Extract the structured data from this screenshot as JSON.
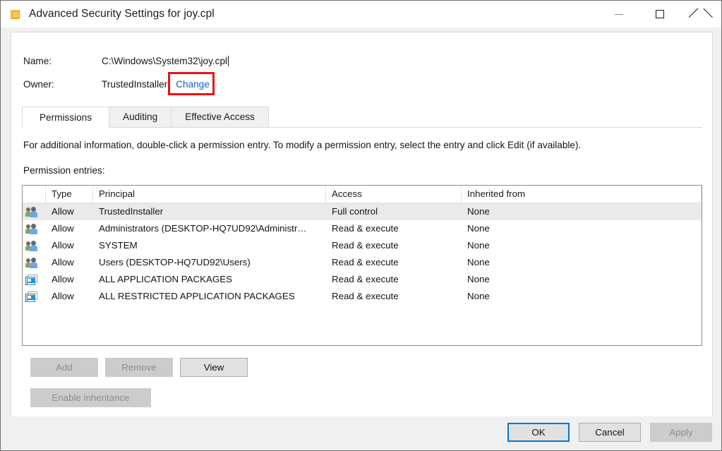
{
  "window": {
    "title": "Advanced Security Settings for joy.cpl",
    "icon": "folder-icon",
    "controls": {
      "minimize": "minimize-icon",
      "maximize": "maximize-icon",
      "close": "close-icon"
    }
  },
  "fields": {
    "name_label": "Name:",
    "name_value": "C:\\Windows\\System32\\joy.cpl",
    "owner_label": "Owner:",
    "owner_value": "TrustedInstaller",
    "change_link": "Change"
  },
  "annotation": {
    "color": "#ee1111",
    "target": "Change"
  },
  "tabs": [
    {
      "label": "Permissions",
      "active": true
    },
    {
      "label": "Auditing",
      "active": false
    },
    {
      "label": "Effective Access",
      "active": false
    }
  ],
  "instructions": "For additional information, double-click a permission entry. To modify a permission entry, select the entry and click Edit (if available).",
  "entries_label": "Permission entries:",
  "table": {
    "columns": [
      "",
      "Type",
      "Principal",
      "Access",
      "Inherited from"
    ],
    "rows": [
      {
        "icon": "user-group-icon",
        "type": "Allow",
        "principal": "TrustedInstaller",
        "access": "Full control",
        "inherited": "None",
        "selected": true
      },
      {
        "icon": "user-group-icon",
        "type": "Allow",
        "principal": "Administrators (DESKTOP-HQ7UD92\\Administr…",
        "access": "Read & execute",
        "inherited": "None",
        "selected": false
      },
      {
        "icon": "user-group-icon",
        "type": "Allow",
        "principal": "SYSTEM",
        "access": "Read & execute",
        "inherited": "None",
        "selected": false
      },
      {
        "icon": "user-group-icon",
        "type": "Allow",
        "principal": "Users (DESKTOP-HQ7UD92\\Users)",
        "access": "Read & execute",
        "inherited": "None",
        "selected": false
      },
      {
        "icon": "app-package-icon",
        "type": "Allow",
        "principal": "ALL APPLICATION PACKAGES",
        "access": "Read & execute",
        "inherited": "None",
        "selected": false
      },
      {
        "icon": "app-package-icon",
        "type": "Allow",
        "principal": "ALL RESTRICTED APPLICATION PACKAGES",
        "access": "Read & execute",
        "inherited": "None",
        "selected": false
      }
    ]
  },
  "actions": {
    "add": "Add",
    "remove": "Remove",
    "view": "View",
    "enable_inheritance": "Enable inheritance"
  },
  "footer": {
    "ok": "OK",
    "cancel": "Cancel",
    "apply": "Apply"
  }
}
